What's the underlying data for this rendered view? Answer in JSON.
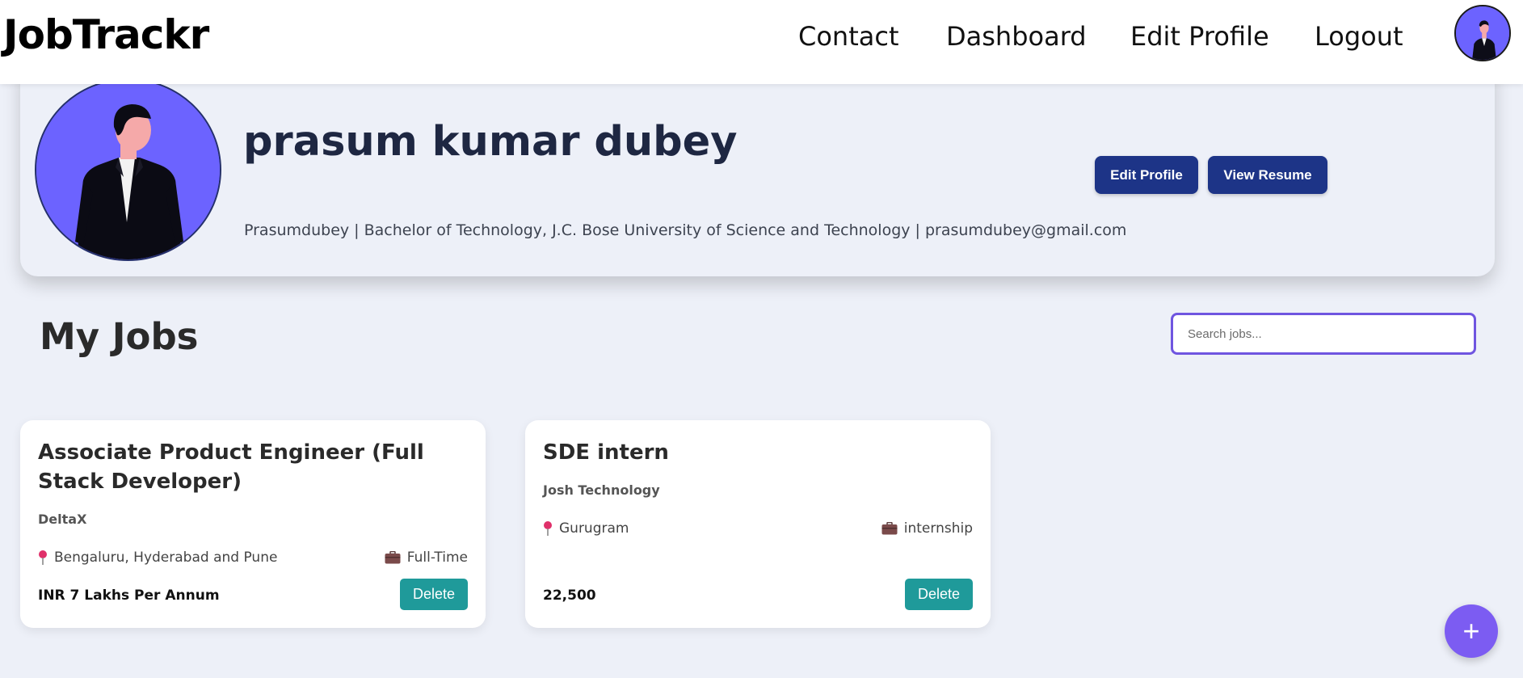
{
  "navbar": {
    "brand": "JobTrackr",
    "links": [
      "Contact",
      "Dashboard",
      "Edit Profile",
      "Logout"
    ]
  },
  "profile": {
    "name": "prasum kumar dubey",
    "meta": "Prasumdubey | Bachelor of Technology, J.C. Bose University of Science and Technology | prasumdubey@gmail.com",
    "edit_button": "Edit Profile",
    "resume_button": "View Resume"
  },
  "jobs_section": {
    "title": "My Jobs",
    "search_placeholder": "Search jobs..."
  },
  "jobs": [
    {
      "title": "Associate Product Engineer (Full Stack Developer)",
      "company": "DeltaX",
      "location": "Bengaluru, Hyderabad and Pune",
      "type": "Full-Time",
      "salary": "INR 7 Lakhs Per Annum",
      "delete_label": "Delete"
    },
    {
      "title": "SDE intern",
      "company": "Josh Technology",
      "location": "Gurugram",
      "type": "internship",
      "salary": "22,500",
      "delete_label": "Delete"
    }
  ],
  "fab_label": "+",
  "colors": {
    "accent": "#1d3487",
    "delete": "#1f9a9a",
    "fab": "#7c5cf2",
    "avatar_bg": "#6c63ff",
    "background": "#edf0f8"
  },
  "icons": {
    "location": "map-pin-icon",
    "job_type": "briefcase-icon"
  }
}
